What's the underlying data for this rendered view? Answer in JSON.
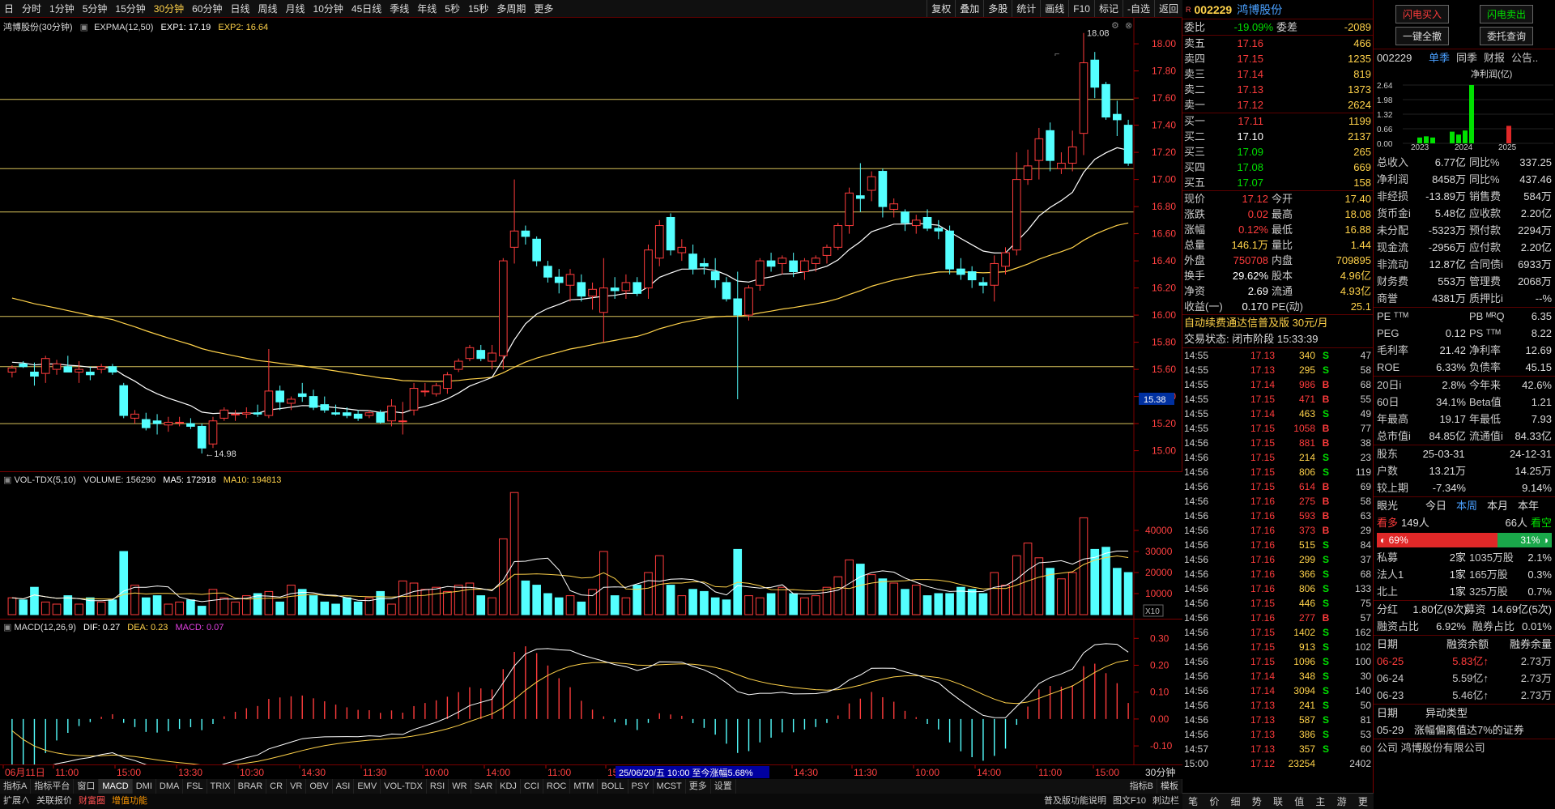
{
  "topbar": {
    "items": [
      "日",
      "分时",
      "1分钟",
      "5分钟",
      "15分钟",
      "30分钟",
      "60分钟",
      "日线",
      "周线",
      "月线",
      "10分钟",
      "45日线",
      "季线",
      "年线",
      "5秒",
      "15秒",
      "多周期",
      "更多"
    ],
    "active_index": 5,
    "right_items": [
      "复权",
      "叠加",
      "多股",
      "统计",
      "画线",
      "F10",
      "标记",
      "-自选",
      "返回"
    ]
  },
  "main": {
    "title": "鸿博股份(30分钟)",
    "indicator": "EXPMA(12,50)",
    "exp1_label": "EXP1: 17.19",
    "exp2_label": "EXP2: 16.64",
    "high_label": "18.08",
    "low_label": "14.98",
    "current_price_tag": "15.38",
    "y_ticks": [
      "18.00",
      "17.80",
      "17.60",
      "17.40",
      "17.20",
      "17.00",
      "16.80",
      "16.60",
      "16.40",
      "16.20",
      "16.00",
      "15.80",
      "15.60",
      "15.40",
      "15.20",
      "15.00"
    ]
  },
  "volume": {
    "indicator": "VOL-TDX(5,10)",
    "volume_label": "VOLUME: 156290",
    "ma5_label": "MA5: 172918",
    "ma10_label": "MA10: 194813",
    "y_ticks": [
      "40000",
      "30000",
      "20000",
      "10000"
    ],
    "unit": "X10"
  },
  "macd": {
    "indicator": "MACD(12,26,9)",
    "dif_label": "DIF: 0.27",
    "dea_label": "DEA: 0.23",
    "macd_label": "MACD: 0.07",
    "y_ticks": [
      "0.30",
      "0.20",
      "0.10",
      "0.00",
      "-0.10"
    ]
  },
  "timeaxis": {
    "labels": [
      "06月11日",
      "11:00",
      "15:00",
      "13:30",
      "10:30",
      "14:30",
      "11:30",
      "10:00",
      "14:00",
      "11:00",
      "15",
      "14:30",
      "11:30",
      "10:00",
      "14:00",
      "11:00",
      "15:00"
    ],
    "highlight": "25/06/20/五 10:00  至今涨幅5.68%",
    "period": "30分钟"
  },
  "tabs": [
    "指标A",
    "指标平台",
    "窗口",
    "MACD",
    "DMI",
    "DMA",
    "FSL",
    "TRIX",
    "BRAR",
    "CR",
    "VR",
    "OBV",
    "ASI",
    "EMV",
    "VOL-TDX",
    "RSI",
    "WR",
    "SAR",
    "KDJ",
    "CCI",
    "ROC",
    "MTM",
    "BOLL",
    "PSY",
    "MCST",
    "更多",
    "设置"
  ],
  "tabs_right": [
    "指标B",
    "模板"
  ],
  "tabs2": [
    "扩展∧",
    "关联报价",
    "财富圈",
    "增值功能"
  ],
  "tabs2_right": [
    "普及版功能说明",
    "图文F10",
    "刺边栏"
  ],
  "quote": {
    "code": "002229",
    "name": "鸿博股份",
    "weibi_label": "委比",
    "weibi": "-19.09%",
    "weicha_label": "委差",
    "weicha": "-2089",
    "asks": [
      {
        "label": "卖五",
        "price": "17.16",
        "vol": "466"
      },
      {
        "label": "卖四",
        "price": "17.15",
        "vol": "1235"
      },
      {
        "label": "卖三",
        "price": "17.14",
        "vol": "819"
      },
      {
        "label": "卖二",
        "price": "17.13",
        "vol": "1373"
      },
      {
        "label": "卖一",
        "price": "17.12",
        "vol": "2624"
      }
    ],
    "bids": [
      {
        "label": "买一",
        "price": "17.11",
        "vol": "1199"
      },
      {
        "label": "买二",
        "price": "17.10",
        "vol": "2137"
      },
      {
        "label": "买三",
        "price": "17.09",
        "vol": "265"
      },
      {
        "label": "买四",
        "price": "17.08",
        "vol": "669"
      },
      {
        "label": "买五",
        "price": "17.07",
        "vol": "158"
      }
    ],
    "stats": [
      [
        "现价",
        "17.12",
        "今开",
        "17.40"
      ],
      [
        "涨跌",
        "0.02",
        "最高",
        "18.08"
      ],
      [
        "涨幅",
        "0.12%",
        "最低",
        "16.88"
      ],
      [
        "总量",
        "146.1万",
        "量比",
        "1.44"
      ],
      [
        "外盘",
        "750708",
        "内盘",
        "709895"
      ],
      [
        "换手",
        "29.62%",
        "股本",
        "4.96亿"
      ],
      [
        "净资",
        "2.69",
        "流通",
        "4.93亿"
      ],
      [
        "收益(一)",
        "0.170",
        "PE(动)",
        "25.1"
      ]
    ],
    "ad": "自动续费通达信普及版 30元/月",
    "status": "交易状态: 闭市阶段 15:33:39",
    "ticks": [
      [
        "14:55",
        "17.13",
        "340",
        "S",
        "47"
      ],
      [
        "14:55",
        "17.13",
        "295",
        "S",
        "58"
      ],
      [
        "14:55",
        "17.14",
        "986",
        "B",
        "68"
      ],
      [
        "14:55",
        "17.15",
        "471",
        "B",
        "55"
      ],
      [
        "14:55",
        "17.14",
        "463",
        "S",
        "49"
      ],
      [
        "14:55",
        "17.15",
        "1058",
        "B",
        "77"
      ],
      [
        "14:56",
        "17.15",
        "881",
        "B",
        "38"
      ],
      [
        "14:56",
        "17.15",
        "214",
        "S",
        "23"
      ],
      [
        "14:56",
        "17.15",
        "806",
        "S",
        "119"
      ],
      [
        "14:56",
        "17.15",
        "614",
        "B",
        "69"
      ],
      [
        "14:56",
        "17.16",
        "275",
        "B",
        "58"
      ],
      [
        "14:56",
        "17.16",
        "593",
        "B",
        "63"
      ],
      [
        "14:56",
        "17.16",
        "373",
        "B",
        "29"
      ],
      [
        "14:56",
        "17.16",
        "515",
        "S",
        "84"
      ],
      [
        "14:56",
        "17.16",
        "299",
        "S",
        "37"
      ],
      [
        "14:56",
        "17.16",
        "366",
        "S",
        "68"
      ],
      [
        "14:56",
        "17.16",
        "806",
        "S",
        "133"
      ],
      [
        "14:56",
        "17.15",
        "446",
        "S",
        "75"
      ],
      [
        "14:56",
        "17.16",
        "277",
        "B",
        "57"
      ],
      [
        "14:56",
        "17.15",
        "1402",
        "S",
        "162"
      ],
      [
        "14:56",
        "17.15",
        "913",
        "S",
        "102"
      ],
      [
        "14:56",
        "17.15",
        "1096",
        "S",
        "100"
      ],
      [
        "14:56",
        "17.14",
        "348",
        "S",
        "30"
      ],
      [
        "14:56",
        "17.14",
        "3094",
        "S",
        "140"
      ],
      [
        "14:56",
        "17.13",
        "241",
        "S",
        "50"
      ],
      [
        "14:56",
        "17.13",
        "587",
        "S",
        "81"
      ],
      [
        "14:56",
        "17.13",
        "386",
        "S",
        "53"
      ],
      [
        "14:57",
        "17.13",
        "357",
        "S",
        "60"
      ],
      [
        "15:00",
        "17.12",
        "23254",
        "",
        "2402"
      ]
    ],
    "bottom": [
      "笔",
      "价",
      "细",
      "势",
      "联",
      "值",
      "主",
      "游",
      "更"
    ]
  },
  "fund": {
    "buttons": [
      "闪电买入",
      "闪电卖出",
      "一键全撤",
      "委托查询"
    ],
    "code": "002229",
    "tabs": [
      "单季",
      "同季",
      "财报",
      "公告.."
    ],
    "chart_title": "净利润(亿)",
    "chart_y": [
      "2.64",
      "1.98",
      "1.32",
      "0.66",
      "0.00"
    ],
    "chart_x": [
      "2023",
      "2024",
      "2025"
    ],
    "rows1": [
      [
        "总收入",
        "6.77亿",
        "同比%",
        "337.25"
      ],
      [
        "净利润",
        "8458万",
        "同比%",
        "437.46"
      ],
      [
        "非经损",
        "-13.89万",
        "销售费",
        "584万"
      ],
      [
        "货币金i",
        "5.48亿",
        "应收款",
        "2.20亿"
      ],
      [
        "未分配",
        "-5323万",
        "预付款",
        "2294万"
      ],
      [
        "现金流",
        "-2956万",
        "应付款",
        "2.20亿"
      ],
      [
        "非流动",
        "12.87亿",
        "合同债i",
        "6933万"
      ],
      [
        "财务费",
        "553万",
        "管理费",
        "2068万"
      ],
      [
        "商誉",
        "4381万",
        "质押比i",
        "--%"
      ]
    ],
    "rows2": [
      [
        "PE ᵀᵀᴹ",
        "",
        "PB ᴹᴿQ",
        "6.35"
      ],
      [
        "PEG",
        "0.12",
        "PS ᵀᵀᴹ",
        "8.22"
      ],
      [
        "毛利率",
        "21.42",
        "净利率",
        "12.69"
      ],
      [
        "ROE",
        "6.33%",
        "负债率",
        "45.15"
      ]
    ],
    "rows3": [
      [
        "20日i",
        "2.8%",
        "今年来",
        "42.6%"
      ],
      [
        "60日",
        "34.1%",
        "Beta值",
        "1.21"
      ],
      [
        "年最高",
        "19.17",
        "年最低",
        "7.93"
      ],
      [
        "总市值i",
        "84.85亿",
        "流通值i",
        "84.33亿"
      ]
    ],
    "rows4": [
      [
        "股东",
        "25-03-31",
        "",
        "24-12-31"
      ],
      [
        "户数",
        "13.21万",
        "",
        "14.25万"
      ],
      [
        "较上期",
        "-7.34%",
        "",
        "9.14%"
      ]
    ],
    "yanguang": {
      "label": "眼光",
      "tabs": [
        "今日",
        "本周",
        "本月",
        "本年"
      ],
      "bull": "看多",
      "bull_n": "149人",
      "bear_n": "66人",
      "bear": "看空",
      "bull_pct": "69%",
      "bear_pct": "31%"
    },
    "holders": [
      [
        "私募",
        "2家",
        "1035万股",
        "2.1%"
      ],
      [
        "法人1",
        "1家",
        "165万股",
        "0.3%"
      ],
      [
        "北上",
        "1家",
        "325万股",
        "0.7%"
      ]
    ],
    "dividend": [
      "分红",
      "1.80亿(9次)",
      "募资",
      "14.69亿(5次)"
    ],
    "margin": [
      "融资占比",
      "6.92%",
      "融券占比",
      "0.01%"
    ],
    "margin_head": [
      "日期",
      "融资余额",
      "融券余量"
    ],
    "margin_rows": [
      [
        "06-25",
        "5.83亿↑",
        "2.73万"
      ],
      [
        "06-24",
        "5.59亿↑",
        "2.73万"
      ],
      [
        "06-23",
        "5.46亿↑",
        "2.73万"
      ]
    ],
    "event_head": [
      "日期",
      "异动类型"
    ],
    "event": [
      "05-29",
      "涨幅偏离值达7%的证券"
    ],
    "company": "公司  鸿博股份有限公司"
  }
}
